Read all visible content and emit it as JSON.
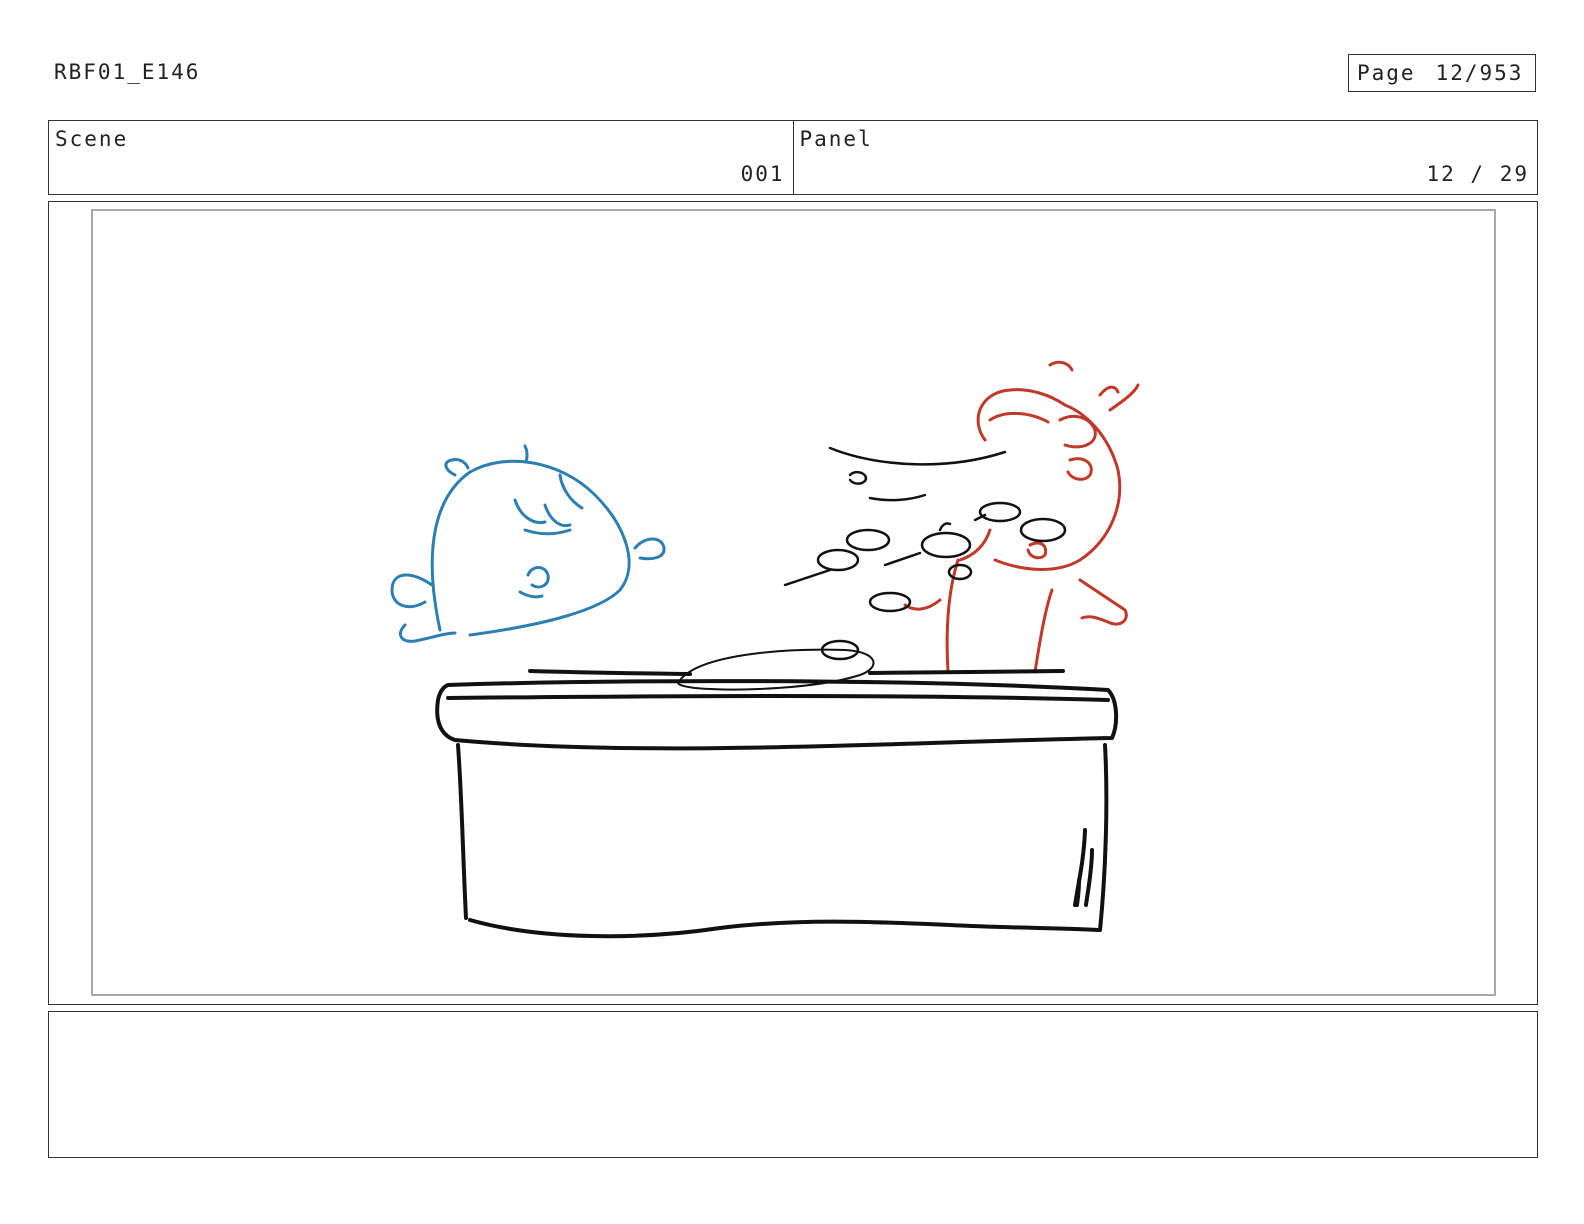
{
  "header": {
    "doc_id": "RBF01_E146",
    "page_label": "Page",
    "page_value": "12/953"
  },
  "info": {
    "scene_label": "Scene",
    "scene_value": "001",
    "panel_label": "Panel",
    "panel_value": "12 / 29"
  },
  "colors": {
    "blue_character": "#2c7fb0",
    "red_character": "#c0392b",
    "ink": "#111111"
  },
  "notes": {
    "text": ""
  }
}
